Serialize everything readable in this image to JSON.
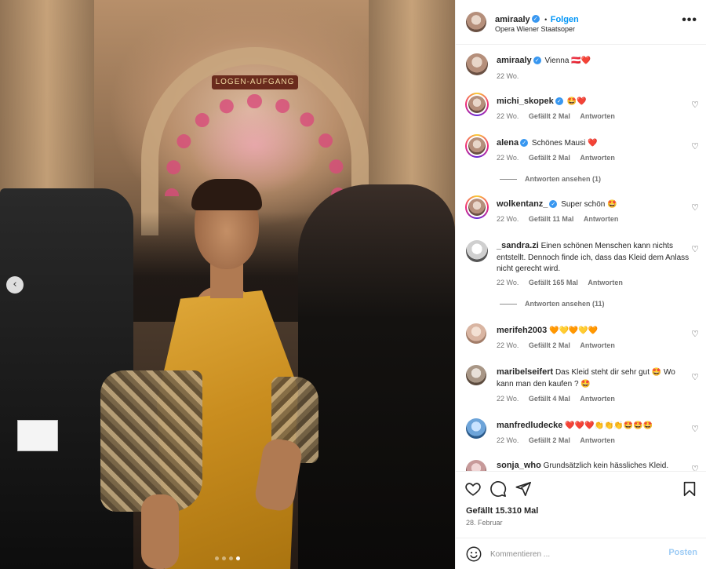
{
  "photo": {
    "sign_text": "LOGEN-AUFGANG",
    "prev_icon": "chevron-left-icon",
    "carousel_total": 4,
    "carousel_active": 4
  },
  "header": {
    "username": "amiraaly",
    "separator": "•",
    "follow_label": "Folgen",
    "location": "Opera Wiener Staatsoper",
    "more_icon": "more-horizontal-icon",
    "more_glyph": "•••"
  },
  "caption": {
    "username": "amiraaly",
    "text": "Vienna 🇦🇹❤️",
    "time": "22 Wo."
  },
  "comments": [
    {
      "username": "michi_skopek",
      "verified": true,
      "text": "🤩❤️",
      "time": "22 Wo.",
      "likes": "Gefällt 2 Mal",
      "reply": "Antworten"
    },
    {
      "username": "alena",
      "verified": true,
      "text": "Schönes Mausi ❤️",
      "time": "22 Wo.",
      "likes": "Gefällt 2 Mal",
      "reply": "Antworten",
      "view_replies": "Antworten ansehen (1)"
    },
    {
      "username": "wolkentanz_",
      "verified": true,
      "text": "Super schön 🤩",
      "time": "22 Wo.",
      "likes": "Gefällt 11 Mal",
      "reply": "Antworten"
    },
    {
      "username": "_sandra.zi",
      "verified": false,
      "text": "Einen schönen Menschen kann nichts entstellt. Dennoch finde ich, dass das Kleid dem Anlass nicht gerecht wird.",
      "time": "22 Wo.",
      "likes": "Gefällt 165 Mal",
      "reply": "Antworten",
      "view_replies": "Antworten ansehen (11)"
    },
    {
      "username": "merifeh2003",
      "verified": false,
      "text": "🧡💛🧡💛🧡",
      "time": "22 Wo.",
      "likes": "Gefällt 2 Mal",
      "reply": "Antworten"
    },
    {
      "username": "maribelseifert",
      "verified": false,
      "text": "Das Kleid steht dir sehr gut 🤩 Wo kann man den kaufen ? 🤩",
      "time": "22 Wo.",
      "likes": "Gefällt 4 Mal",
      "reply": "Antworten"
    },
    {
      "username": "manfredludecke",
      "verified": false,
      "text": "❤️❤️❤️👏👏👏🤩🤩🤩",
      "time": "22 Wo.",
      "likes": "Gefällt 2 Mal",
      "reply": "Antworten"
    },
    {
      "username": "sonja_who",
      "verified": false,
      "text": "Grundsätzlich kein hässliches Kleid.",
      "time": "",
      "likes": "",
      "reply": ""
    }
  ],
  "actions": {
    "like_icon": "heart-icon",
    "comment_icon": "comment-icon",
    "share_icon": "send-icon",
    "save_icon": "bookmark-icon",
    "likes_text": "Gefällt 15.310 Mal",
    "date_text": "28. Februar"
  },
  "compose": {
    "emoji_icon": "emoji-icon",
    "placeholder": "Kommentieren ...",
    "post_label": "Posten"
  },
  "colors": {
    "accent": "#0095f6",
    "post_disabled": "#9ccbf5",
    "verified": "#3897f0",
    "dress": "#d19a2a"
  }
}
